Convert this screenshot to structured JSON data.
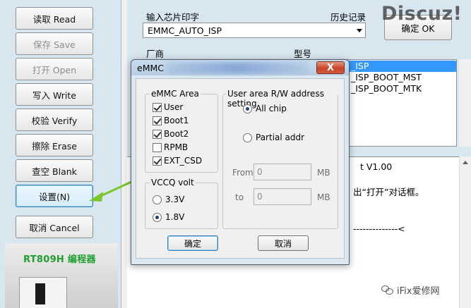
{
  "sidebar": {
    "buttons": [
      {
        "label": "读取 Read",
        "state": "enabled"
      },
      {
        "label": "保存 Save",
        "state": "disabled"
      },
      {
        "label": "打开 Open",
        "state": "disabled"
      },
      {
        "label": "写入 Write",
        "state": "enabled"
      },
      {
        "label": "校验 Verify",
        "state": "enabled"
      },
      {
        "label": "擦除 Erase",
        "state": "enabled"
      },
      {
        "label": "查空 Blank",
        "state": "enabled"
      },
      {
        "label": "设置(N)",
        "state": "focused"
      },
      {
        "label": "取消 Cancel",
        "state": "enabled"
      }
    ],
    "product": {
      "label": "RT809H 编程器"
    }
  },
  "main": {
    "chip_marking_label": "输入芯片印字",
    "history_label": "历史记录",
    "chip_marking_value": "EMMC_AUTO_ISP",
    "confirm_label": "确定 OK",
    "vendor_label": "厂商",
    "model_label": "型号",
    "model_items": [
      {
        "text": "_ISP",
        "selected": true
      },
      {
        "text": "_ISP_BOOT_MST",
        "selected": false
      },
      {
        "text": "_ISP_BOOT_MTK",
        "selected": false
      }
    ],
    "log_lines": [
      "t V1.00",
      "出“打开”对话框。",
      "--------------<"
    ]
  },
  "watermark": {
    "top": "Discuz!",
    "footer": "iFix爱修网"
  },
  "dialog": {
    "title": "eMMC",
    "close_label": "X",
    "emmc_area": {
      "title": "eMMC Area",
      "items": [
        {
          "label": "User",
          "checked": true
        },
        {
          "label": "Boot1",
          "checked": true
        },
        {
          "label": "Boot2",
          "checked": true
        },
        {
          "label": "RPMB",
          "checked": false
        },
        {
          "label": "EXT_CSD",
          "checked": true
        }
      ]
    },
    "vccq": {
      "title": "VCCQ volt",
      "options": [
        {
          "label": "3.3V",
          "selected": false
        },
        {
          "label": "1.8V",
          "selected": true
        }
      ]
    },
    "rw_setting": {
      "title": "User area R/W address setting",
      "options": [
        {
          "label": "All chip",
          "selected": true
        },
        {
          "label": "Partial addr",
          "selected": false
        }
      ],
      "from_label": "From",
      "from_value": "0",
      "to_label": "to",
      "to_value": "0",
      "unit": "MB"
    },
    "ok_label": "确定",
    "cancel_label": "取消"
  },
  "colors": {
    "accent_arrow": "#7bc62a",
    "selection": "#3399ff",
    "brand_green": "#1f9f2f"
  }
}
